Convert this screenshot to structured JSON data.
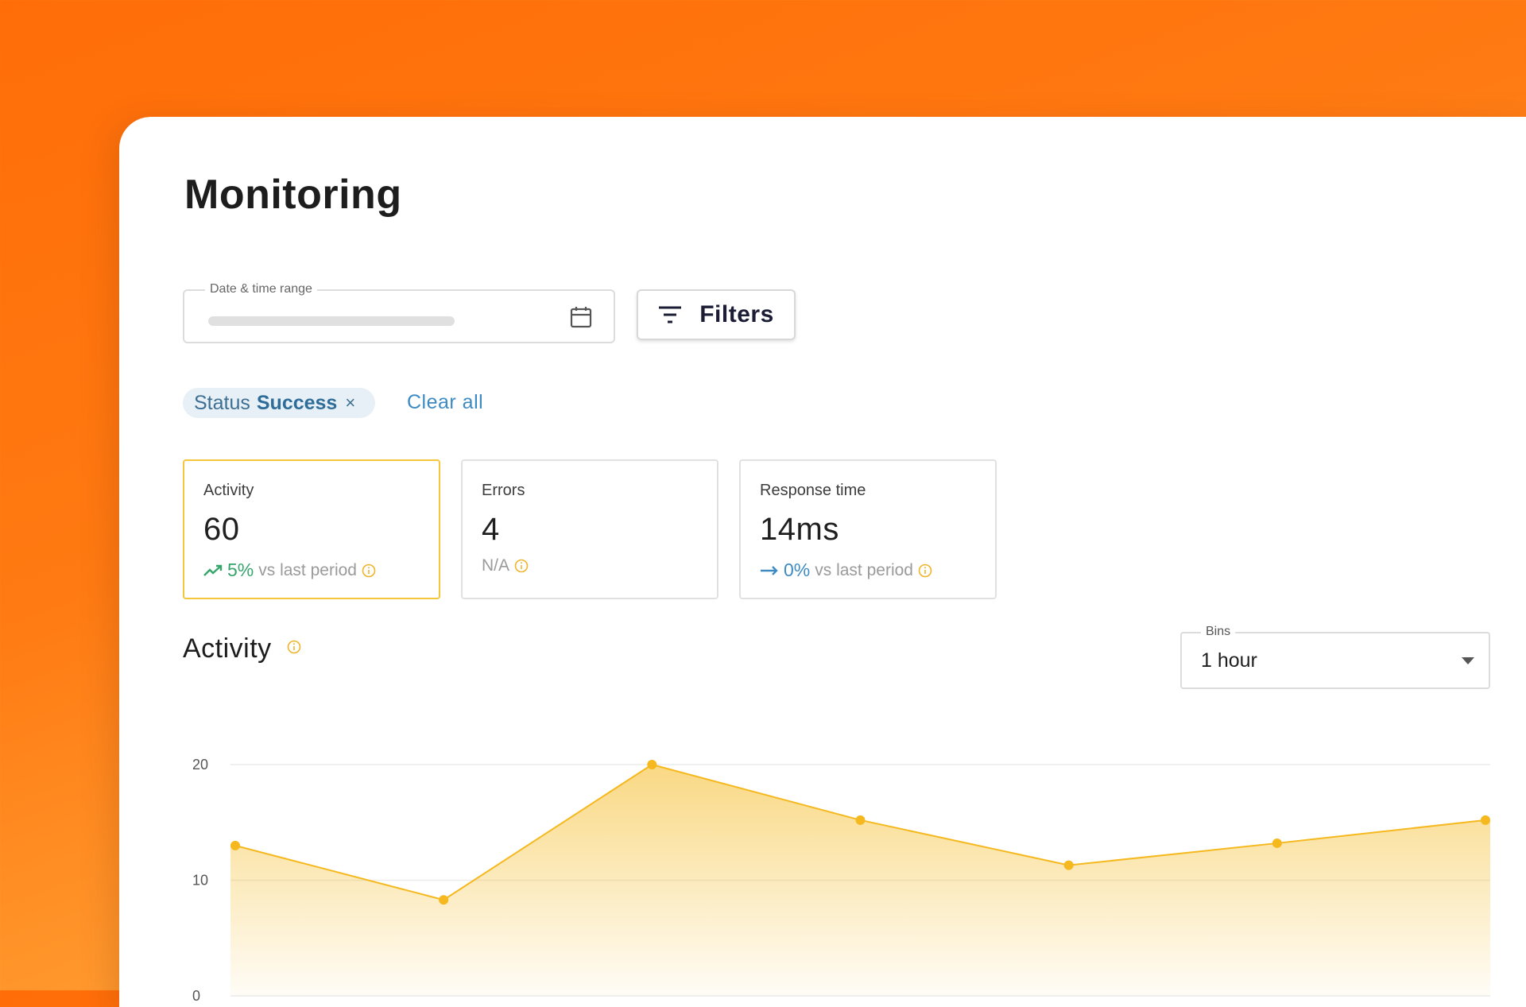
{
  "page": {
    "title": "Monitoring"
  },
  "date_range": {
    "label": "Date & time range",
    "value": ""
  },
  "filters_button": {
    "label": "Filters"
  },
  "active_filter": {
    "key": "Status",
    "value": "Success",
    "remove_symbol": "×"
  },
  "clear_all": "Clear all",
  "cards": [
    {
      "label": "Activity",
      "value": "60",
      "delta": "5%",
      "suffix": "vs last period",
      "trend": "up",
      "selected": true
    },
    {
      "label": "Errors",
      "value": "4",
      "note": "N/A"
    },
    {
      "label": "Response time",
      "value": "14ms",
      "delta": "0%",
      "suffix": "vs last period",
      "trend": "flat"
    }
  ],
  "activity_section": {
    "title": "Activity"
  },
  "bins": {
    "label": "Bins",
    "value": "1 hour"
  },
  "colors": {
    "accent": "#f5b91f",
    "positive": "#35a56b",
    "neutral": "#3d8bc2",
    "brand_orange": "#ff6d08"
  },
  "chart_data": {
    "type": "area",
    "x": [
      1,
      2,
      3,
      4,
      5,
      6,
      7
    ],
    "values": [
      13,
      8.3,
      20,
      15.2,
      11.3,
      13.2,
      15.2
    ],
    "ylim": [
      0,
      20
    ],
    "yticks": [
      "20",
      "10",
      "0"
    ],
    "grid": true,
    "color": "#f5b91f"
  }
}
